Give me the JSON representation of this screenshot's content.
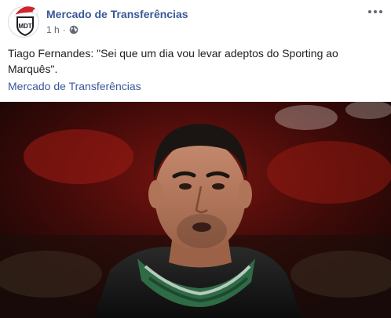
{
  "post": {
    "page_name": "Mercado de Transferências",
    "time": "1 h",
    "separator": "·",
    "audience_icon": "globe-icon",
    "more_icon": "more-options-icon",
    "text": "Tiago Fernandes: \"Sei que um dia vou levar adeptos do Sporting ao Marquês\".",
    "link_text": "Mercado de Transferências",
    "avatar_initials": "MDT",
    "photo_icon": "man-portrait-photo"
  },
  "colors": {
    "link": "#385898",
    "meta": "#606770",
    "brand_red": "#d2232a"
  }
}
